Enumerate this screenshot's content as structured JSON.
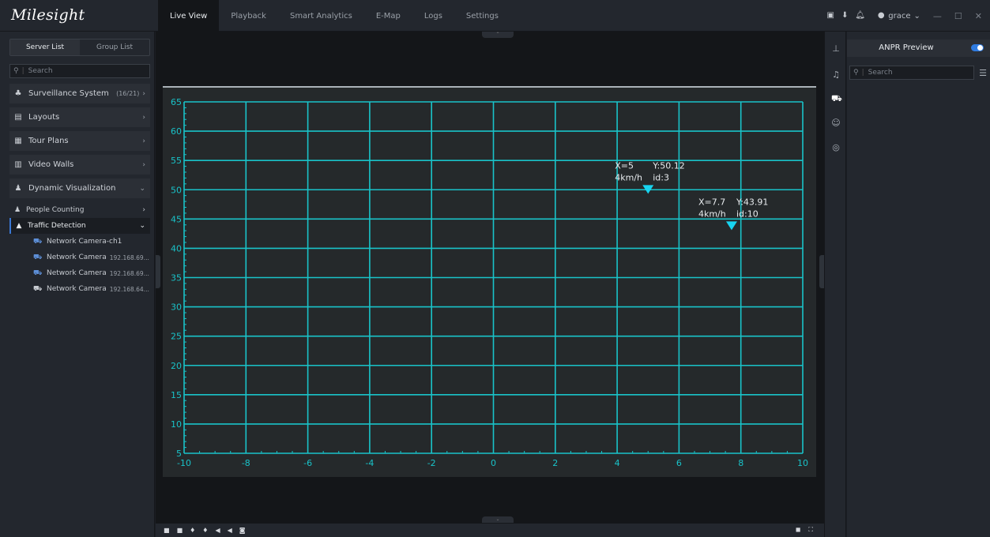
{
  "app": {
    "logo": "Milesight"
  },
  "nav": {
    "tabs": [
      "Live View",
      "Playback",
      "Smart Analytics",
      "E-Map",
      "Logs",
      "Settings"
    ]
  },
  "topbar": {
    "user": "grace"
  },
  "sidebar": {
    "seg": [
      "Server List",
      "Group List"
    ],
    "search_placeholder": "Search",
    "items": [
      {
        "label": "Surveillance System",
        "count": "(16/21)"
      },
      {
        "label": "Layouts"
      },
      {
        "label": "Tour Plans"
      },
      {
        "label": "Video Walls"
      },
      {
        "label": "Dynamic Visualization"
      }
    ],
    "subs": [
      {
        "label": "People Counting"
      },
      {
        "label": "Traffic Detection"
      }
    ],
    "cameras": [
      {
        "name": "Network Camera-ch1",
        "ip": ""
      },
      {
        "name": "Network Camera",
        "ip": "192.168.69..."
      },
      {
        "name": "Network Camera",
        "ip": "192.168.69..."
      },
      {
        "name": "Network Camera",
        "ip": "192.168.64..."
      }
    ]
  },
  "right_panel": {
    "title": "ANPR Preview",
    "search_placeholder": "Search",
    "toggle_on": true
  },
  "colors": {
    "grid": "#19c3c9",
    "marker": "#17d4f0",
    "accent": "#2f7be0",
    "background": "#141619"
  },
  "chart_data": {
    "type": "scatter",
    "xlim": [
      -10,
      10
    ],
    "ylim": [
      5,
      65
    ],
    "x_ticks": [
      -10,
      -8,
      -6,
      -4,
      -2,
      0,
      2,
      4,
      6,
      8,
      10
    ],
    "y_ticks": [
      5,
      10,
      15,
      20,
      25,
      30,
      35,
      40,
      45,
      50,
      55,
      60,
      65
    ],
    "grid": true,
    "points": [
      {
        "x": 5,
        "y": 50.12,
        "label_x": "X=5",
        "label_y": "Y:50.12",
        "speed": "4km/h",
        "id": "id:3"
      },
      {
        "x": 7.7,
        "y": 43.91,
        "label_x": "X=7.7",
        "label_y": "Y:43.91",
        "speed": "4km/h",
        "id": "id:10"
      }
    ]
  }
}
